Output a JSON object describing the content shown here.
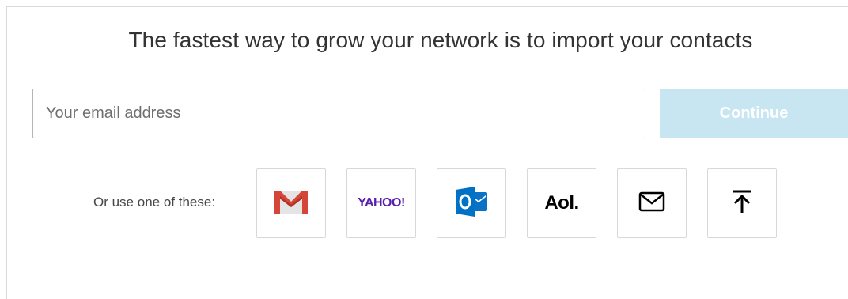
{
  "header": {
    "headline": "The fastest way to grow your network is to import your contacts"
  },
  "email": {
    "placeholder": "Your email address",
    "value": ""
  },
  "continue_button": {
    "label": "Continue",
    "bg_color": "#c8e6f2"
  },
  "alternatives": {
    "label": "Or use one of these:",
    "providers": [
      {
        "name": "Gmail",
        "icon": "gmail-icon"
      },
      {
        "name": "Yahoo",
        "icon": "yahoo-logo",
        "text": "YAHOO!"
      },
      {
        "name": "Outlook",
        "icon": "outlook-icon"
      },
      {
        "name": "AOL",
        "icon": "aol-logo",
        "text": "Aol."
      },
      {
        "name": "Other email",
        "icon": "envelope-icon"
      },
      {
        "name": "Upload file",
        "icon": "upload-icon"
      }
    ]
  }
}
